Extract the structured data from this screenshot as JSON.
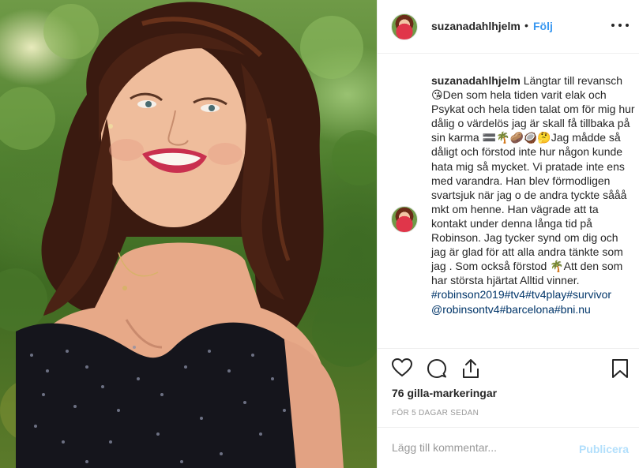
{
  "post": {
    "username": "suzanadahlhjelm",
    "separator": "•",
    "follow_label": "Följ",
    "more_icon": "more-horizontal-icon"
  },
  "caption": {
    "username": "suzanadahlhjelm",
    "text_1": " Längtar till revansch ",
    "emoji_1": "😘",
    "text_2": "Den som hela tiden varit elak och Psykat och hela tiden talat om för mig hur dålig o värdelös jag är skall få tillbaka på sin karma ",
    "emoji_2": "🟰🌴🥔🥥🤔",
    "text_3": "Jag mådde så dåligt och förstod inte hur någon kunde hata mig så mycket. Vi pratade inte ens med varandra. Han blev förmodligen svartsjuk när jag o de andra tyckte sååå mkt om henne. Han vägrade att ta kontakt under denna långa tid på Robinson. Jag tycker synd om dig och jag är glad för att alla andra tänkte som jag . Som också förstod ",
    "emoji_3": "🌴",
    "text_4": "Att den som har största hjärtat Alltid vinner.",
    "tags": "#robinson2019#tv4#tv4play#survivor @robinsontv4#barcelona#bni.nu"
  },
  "actions": {
    "like_icon": "heart-icon",
    "comment_icon": "comment-icon",
    "share_icon": "share-icon",
    "save_icon": "bookmark-icon"
  },
  "likes": "76 gilla-markeringar",
  "time": "FÖR 5 DAGAR SEDAN",
  "comment_box": {
    "placeholder": "Lägg till kommentar...",
    "post_label": "Publicera"
  },
  "colors": {
    "link": "#3897f0",
    "hashtag": "#003569",
    "post_disabled": "#b2dffc",
    "border": "#efefef"
  }
}
